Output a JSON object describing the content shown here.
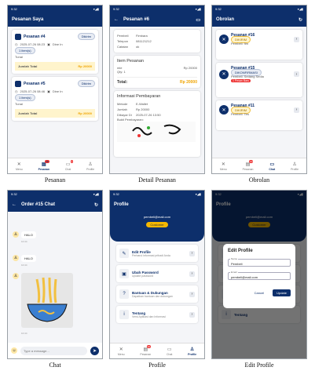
{
  "captions": [
    "Pesanan",
    "Detail Pesanan",
    "Obrolan",
    "Chat",
    "Profile",
    "Edit Profile"
  ],
  "status_time": "9:32",
  "nav": {
    "home": "Menu",
    "orders": "Pesanan",
    "chat": "Chat",
    "profile": "Profile",
    "orders_badge": "10",
    "chat_badge": "1"
  },
  "pesanan": {
    "title": "Pesanan Saya",
    "orders": [
      {
        "name": "Pesanan #4",
        "status": "Dikirim",
        "date": "2025-07-26 08:23",
        "method": "Dine In",
        "items": "1 item(s)",
        "note": "Tunai",
        "total_label": "Jumlah Total",
        "total": "Rp 20000"
      },
      {
        "name": "Pesanan #5",
        "status": "Dikirim",
        "date": "2025-07-26 08:46",
        "method": "Dine In",
        "items": "1 item(s)",
        "note": "Tunai",
        "total_label": "Jumlah Total",
        "total": "Rp 20000"
      }
    ]
  },
  "detail": {
    "title": "Pesanan #6",
    "info": [
      {
        "k": "Pembeli",
        "v": "Fimbara"
      },
      {
        "k": "Telepon",
        "v": "081121212"
      },
      {
        "k": "Catatan",
        "v": "ok"
      }
    ],
    "items_title": "Item Pesanan",
    "item_name": "mie",
    "item_qty": "Qty: 1",
    "item_price": "Rp 20000",
    "total_label": "Total:",
    "total": "Rp 20000",
    "pay_title": "Informasi Pembayaran",
    "pay": [
      {
        "k": "Metode",
        "v": "E-Wallet"
      },
      {
        "k": "Jumlah",
        "v": "Rp 20000"
      },
      {
        "k": "Dibayar Di",
        "v": "2025-07-26 13:50"
      }
    ],
    "proof_label": "Bukti Pembayaran:"
  },
  "obrolan": {
    "title": "Obrolan",
    "chats": [
      {
        "name": "Pesanan #16",
        "tag": "DIKIRIM",
        "sub": "Pembeli: fim",
        "flag": ""
      },
      {
        "name": "Pesanan #15",
        "tag": "DIKONFIRMASI",
        "sub": "Pembeli: Sedang Sedia",
        "flag": "1 Pesan Baru"
      },
      {
        "name": "Pesanan #11",
        "tag": "DIKIRIM",
        "sub": "Pembeli: Tes",
        "flag": ""
      }
    ]
  },
  "chat": {
    "title": "Order #15 Chat",
    "messages": [
      {
        "text": "HALO",
        "time": "10:44"
      },
      {
        "text": "HALO",
        "time": "10:44"
      }
    ],
    "image_time": "10:44",
    "placeholder": "Type a message..."
  },
  "profile": {
    "title": "Profile",
    "email": "pembeli@mail.com",
    "role": "Customer",
    "menu": [
      {
        "title": "Edit Profile",
        "sub": "Perbarui informasi pribadi Anda",
        "icon": "✎"
      },
      {
        "title": "Ubah Password",
        "sub": "Update password",
        "icon": "🔒"
      },
      {
        "title": "Bantuan & Dukungan",
        "sub": "Dapatkan bantuan dan dukungan",
        "icon": "?"
      },
      {
        "title": "Tentang",
        "sub": "Versi Aplikasi dan Informasi",
        "icon": "i"
      }
    ]
  },
  "edit": {
    "title": "Edit Profile",
    "name_label": "Name",
    "name_value": "Pembeli",
    "email_label": "Email",
    "email_value": "pembeli@mail.com",
    "cancel": "Cancel",
    "update": "Update"
  }
}
